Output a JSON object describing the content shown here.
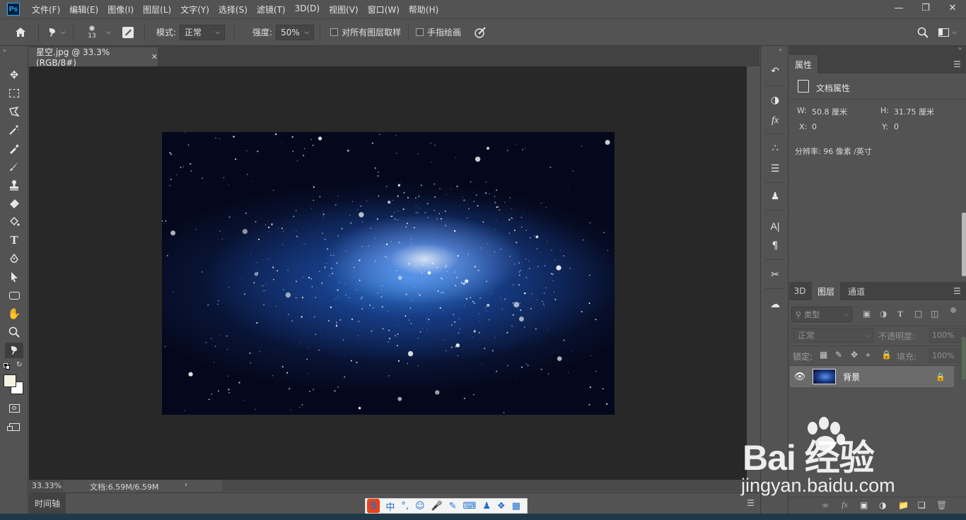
{
  "app": {
    "logo_text": "Ps",
    "menu": [
      "文件(F)",
      "编辑(E)",
      "图像(I)",
      "图层(L)",
      "文字(Y)",
      "选择(S)",
      "滤镜(T)",
      "3D(D)",
      "视图(V)",
      "窗口(W)",
      "帮助(H)"
    ]
  },
  "options": {
    "brush_size": "13",
    "mode_label": "模式:",
    "mode_value": "正常",
    "strength_label": "强度:",
    "strength_value": "50%",
    "sample_all_label": "对所有图层取样",
    "finger_paint_label": "手指绘画"
  },
  "document": {
    "tab_title": "星空.jpg @ 33.3%(RGB/8#)",
    "zoom": "33.33%",
    "doc_size": "文档:6.59M/6.59M",
    "timeline_label": "时间轴"
  },
  "properties": {
    "tab_label": "属性",
    "section_label": "文档属性",
    "w_label": "W:",
    "w_value": "50.8 厘米",
    "h_label": "H:",
    "h_value": "31.75 厘米",
    "x_label": "X:",
    "x_value": "0",
    "y_label": "Y:",
    "y_value": "0",
    "resolution": "分辨率: 96 像素 /英寸"
  },
  "layers": {
    "tabs": [
      "3D",
      "图层",
      "通道"
    ],
    "filter_label": "类型",
    "blend_mode": "正常",
    "opacity_label": "不透明度:",
    "opacity_value": "100%",
    "lock_label": "锁定:",
    "fill_label": "填充:",
    "fill_value": "100%",
    "layer_name": "背景"
  },
  "watermark": {
    "main": "Bai 经验",
    "sub": "jingyan.baidu.com"
  }
}
